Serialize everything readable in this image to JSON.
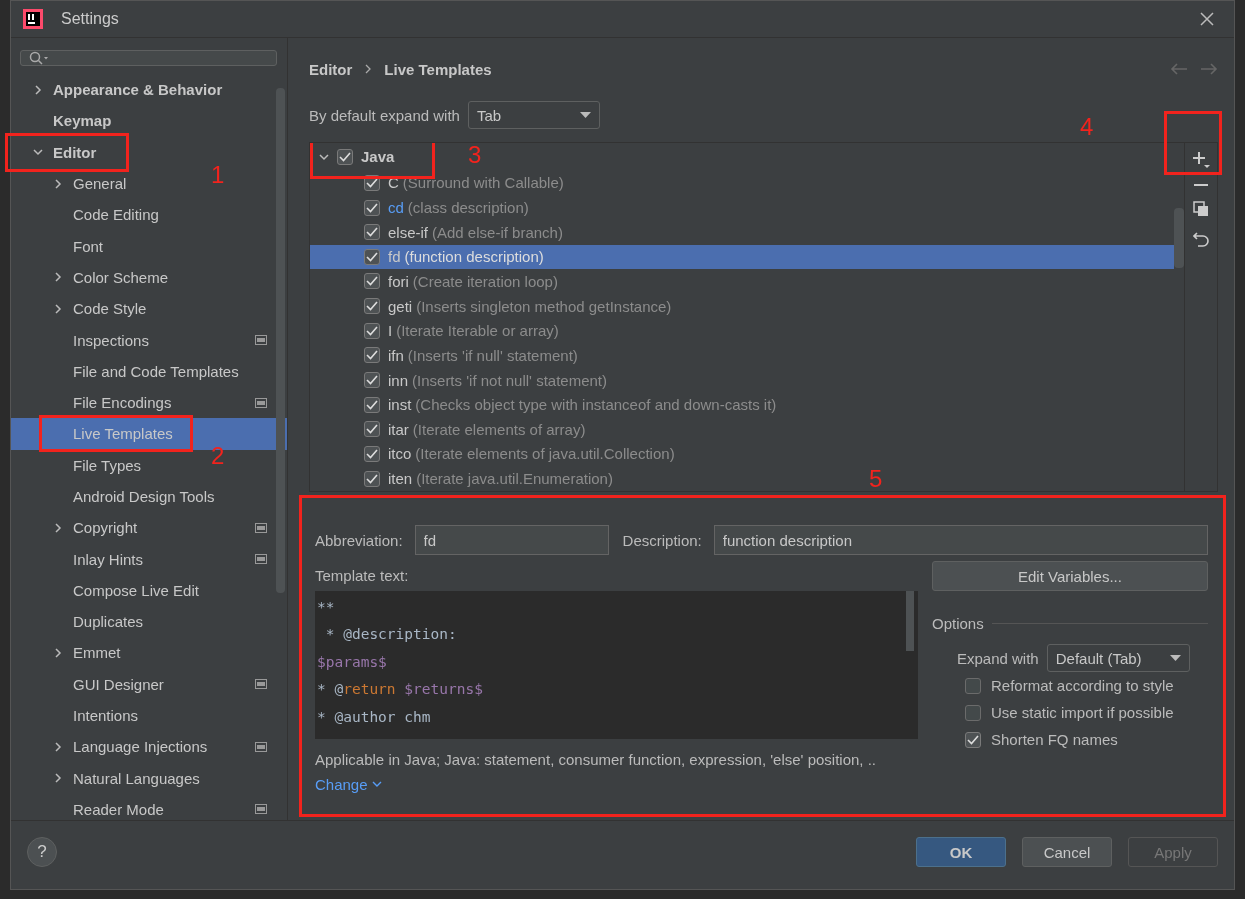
{
  "window": {
    "title": "Settings"
  },
  "sidebar": {
    "items": [
      {
        "label": "Appearance & Behavior",
        "kind": "node",
        "expanded": false,
        "selected": false,
        "project_level": false
      },
      {
        "label": "Keymap",
        "kind": "leaf",
        "selected": false,
        "project_level": false
      },
      {
        "label": "Editor",
        "kind": "node",
        "expanded": true,
        "selected": false,
        "project_level": false,
        "annotation": "1",
        "children": [
          {
            "label": "General",
            "kind": "node",
            "expanded": false,
            "selected": false,
            "project_level": false
          },
          {
            "label": "Code Editing",
            "kind": "leaf",
            "selected": false,
            "project_level": false
          },
          {
            "label": "Font",
            "kind": "leaf",
            "selected": false,
            "project_level": false
          },
          {
            "label": "Color Scheme",
            "kind": "node",
            "expanded": false,
            "selected": false,
            "project_level": false
          },
          {
            "label": "Code Style",
            "kind": "node",
            "expanded": false,
            "selected": false,
            "project_level": false
          },
          {
            "label": "Inspections",
            "kind": "leaf",
            "selected": false,
            "project_level": true
          },
          {
            "label": "File and Code Templates",
            "kind": "leaf",
            "selected": false,
            "project_level": false
          },
          {
            "label": "File Encodings",
            "kind": "leaf",
            "selected": false,
            "project_level": true
          },
          {
            "label": "Live Templates",
            "kind": "leaf",
            "selected": true,
            "project_level": false,
            "annotation": "2"
          },
          {
            "label": "File Types",
            "kind": "leaf",
            "selected": false,
            "project_level": false
          },
          {
            "label": "Android Design Tools",
            "kind": "leaf",
            "selected": false,
            "project_level": false
          },
          {
            "label": "Copyright",
            "kind": "node",
            "expanded": false,
            "selected": false,
            "project_level": true
          },
          {
            "label": "Inlay Hints",
            "kind": "leaf",
            "selected": false,
            "project_level": true
          },
          {
            "label": "Compose Live Edit",
            "kind": "leaf",
            "selected": false,
            "project_level": false
          },
          {
            "label": "Duplicates",
            "kind": "leaf",
            "selected": false,
            "project_level": false
          },
          {
            "label": "Emmet",
            "kind": "node",
            "expanded": false,
            "selected": false,
            "project_level": false
          },
          {
            "label": "GUI Designer",
            "kind": "leaf",
            "selected": false,
            "project_level": true
          },
          {
            "label": "Intentions",
            "kind": "leaf",
            "selected": false,
            "project_level": false
          },
          {
            "label": "Language Injections",
            "kind": "node",
            "expanded": false,
            "selected": false,
            "project_level": true
          },
          {
            "label": "Natural Languages",
            "kind": "node",
            "expanded": false,
            "selected": false,
            "project_level": false
          },
          {
            "label": "Reader Mode",
            "kind": "leaf",
            "selected": false,
            "project_level": true
          }
        ]
      }
    ]
  },
  "breadcrumb": [
    "Editor",
    "Live Templates"
  ],
  "expand_with": {
    "label": "By default expand with",
    "value": "Tab"
  },
  "templates": {
    "group": {
      "label": "Java",
      "checked": true,
      "expanded": true,
      "annotation": "3"
    },
    "rows": [
      {
        "abbreviation": "C",
        "description": "(Surround with Callable)",
        "checked": true,
        "modified": false,
        "selected": false
      },
      {
        "abbreviation": "cd",
        "description": "(class description)",
        "checked": true,
        "modified": true,
        "selected": false
      },
      {
        "abbreviation": "else-if",
        "description": "(Add else-if branch)",
        "checked": true,
        "modified": false,
        "selected": false
      },
      {
        "abbreviation": "fd",
        "description": "(function description)",
        "checked": true,
        "modified": false,
        "selected": true
      },
      {
        "abbreviation": "fori",
        "description": "(Create iteration loop)",
        "checked": true,
        "modified": false,
        "selected": false
      },
      {
        "abbreviation": "geti",
        "description": "(Inserts singleton method getInstance)",
        "checked": true,
        "modified": false,
        "selected": false
      },
      {
        "abbreviation": "I",
        "description": "(Iterate Iterable or array)",
        "checked": true,
        "modified": false,
        "selected": false
      },
      {
        "abbreviation": "ifn",
        "description": "(Inserts 'if null' statement)",
        "checked": true,
        "modified": false,
        "selected": false
      },
      {
        "abbreviation": "inn",
        "description": "(Inserts 'if not null' statement)",
        "checked": true,
        "modified": false,
        "selected": false
      },
      {
        "abbreviation": "inst",
        "description": "(Checks object type with instanceof and down-casts it)",
        "checked": true,
        "modified": false,
        "selected": false
      },
      {
        "abbreviation": "itar",
        "description": "(Iterate elements of array)",
        "checked": true,
        "modified": false,
        "selected": false
      },
      {
        "abbreviation": "itco",
        "description": "(Iterate elements of java.util.Collection)",
        "checked": true,
        "modified": false,
        "selected": false
      },
      {
        "abbreviation": "iten",
        "description": "(Iterate java.util.Enumeration)",
        "checked": true,
        "modified": false,
        "selected": false
      }
    ],
    "add_annotation": "4"
  },
  "editor": {
    "annotation": "5",
    "abbreviation": {
      "label": "Abbreviation:",
      "value": "fd"
    },
    "description": {
      "label": "Description:",
      "value": "function description"
    },
    "template_label": "Template text:",
    "template_lines": [
      [
        {
          "kind": "plain",
          "text": "**"
        }
      ],
      [
        {
          "kind": "plain",
          "text": " * @description:"
        }
      ],
      [
        {
          "kind": "variable",
          "text": "$params$"
        }
      ],
      [
        {
          "kind": "plain",
          "text": "* @"
        },
        {
          "kind": "keyword",
          "text": "return"
        },
        {
          "kind": "variable",
          "text": " $returns$"
        }
      ],
      [
        {
          "kind": "plain",
          "text": "* @author chm"
        }
      ]
    ],
    "applicable": "Applicable in Java; Java: statement, consumer function, expression, 'else' position, ..",
    "change_link": "Change",
    "edit_variables": "Edit Variables...",
    "options_title": "Options",
    "expand_with": {
      "label": "Expand with",
      "value": "Default (Tab)"
    },
    "options": [
      {
        "label": "Reformat according to style",
        "checked": false
      },
      {
        "label": "Use static import if possible",
        "checked": false
      },
      {
        "label": "Shorten FQ names",
        "checked": true
      }
    ]
  },
  "buttons": [
    {
      "label": "OK",
      "kind": "primary"
    },
    {
      "label": "Cancel",
      "kind": "normal"
    },
    {
      "label": "Apply",
      "kind": "disabled"
    }
  ],
  "help": "?"
}
